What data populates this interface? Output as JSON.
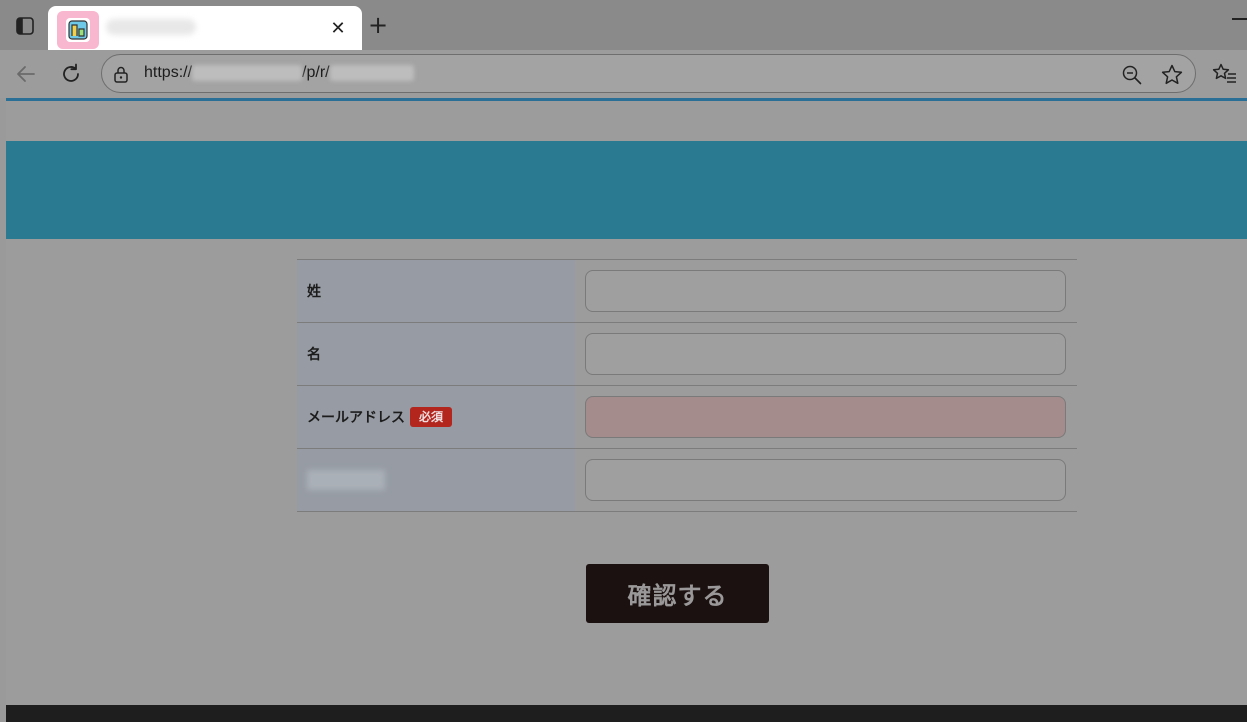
{
  "browser": {
    "tab": {
      "title": "",
      "close_glyph": "✕"
    },
    "new_tab_glyph": "+",
    "address_bar": {
      "url_prefix": "https://",
      "url_middle": "/p/r/",
      "url_host_hidden": "",
      "url_path_hidden": ""
    },
    "icons": {
      "sidebar": "sidebar-icon",
      "favicon": "site-favicon-icon",
      "back": "back-arrow-icon",
      "reload": "reload-icon",
      "lock": "lock-icon",
      "zoom": "zoom-out-icon",
      "favorite": "star-icon",
      "favorites_list": "favorites-list-icon"
    }
  },
  "page": {
    "header_title": "",
    "form": {
      "rows": [
        {
          "label": "姓",
          "value": "",
          "required": false
        },
        {
          "label": "名",
          "value": "",
          "required": false
        },
        {
          "label": "メールアドレス",
          "value": "",
          "required": true
        },
        {
          "label": "",
          "value": "",
          "required": false
        }
      ],
      "required_badge": "必須"
    },
    "confirm_label": "確認する"
  },
  "colors": {
    "header_band": "#2a7a92",
    "required_badge": "#b2261e",
    "required_field": "#a48b8c",
    "confirm_button": "#1a1110",
    "favicon_highlight": "#f9b6cf"
  }
}
